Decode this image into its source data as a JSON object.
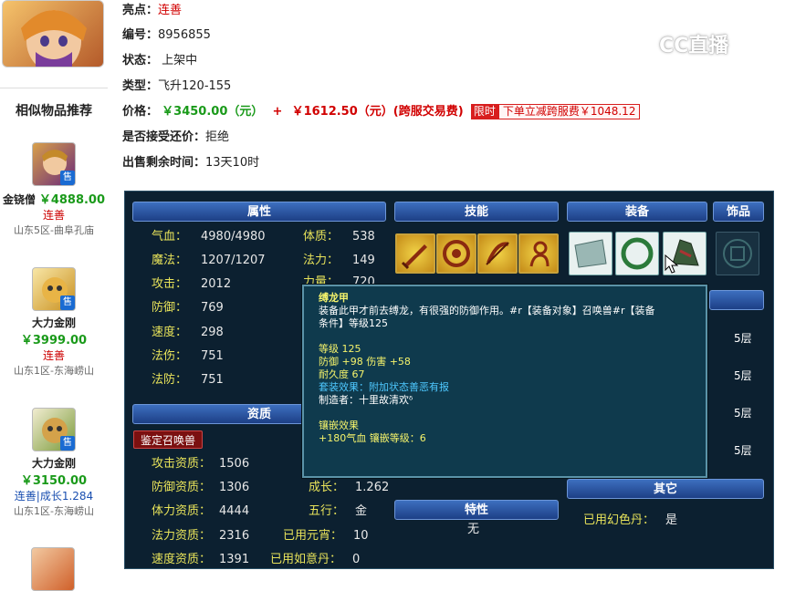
{
  "logo": "CC直播",
  "sidebar": {
    "title": "相似物品推荐",
    "sold_badge": "售",
    "items": [
      {
        "name": "金铙僧",
        "price": "￥4888.00",
        "highlight": "连善",
        "server": "山东5区-曲阜孔庙"
      },
      {
        "name": "大力金刚",
        "price": "￥3999.00",
        "highlight": "连善",
        "server": "山东1区-东海崂山"
      },
      {
        "name": "大力金刚",
        "price": "￥3150.00",
        "highlight": "连善|成长1.284",
        "server": "山东1区-东海崂山"
      }
    ]
  },
  "info": {
    "highlight_label": "亮点：",
    "highlight_value": "连善",
    "id_label": "编号：",
    "id_value": "8956855",
    "status_label": "状态：",
    "status_value": "上架中",
    "type_label": "类型：",
    "type_value": "飞升120-155",
    "price_label": "价格：",
    "price_main": "￥3450.00（元）",
    "price_plus": "+",
    "price_extra": "￥1612.50（元）(跨服交易费)",
    "limit_badge": "限时",
    "limit_offer": "下单立减跨服费￥1048.12",
    "bargain_label": "是否接受还价：",
    "bargain_value": "拒绝",
    "remain_label": "出售剩余时间：",
    "remain_value": "13天10时"
  },
  "panel": {
    "headers": {
      "attributes": "属性",
      "skills": "技能",
      "equipment": "装备",
      "accessory": "饰品",
      "aptitude": "资质",
      "trait": "特性",
      "other": "其它"
    },
    "attrs_left": [
      {
        "k": "气血：",
        "v": "4980/4980"
      },
      {
        "k": "魔法：",
        "v": "1207/1207"
      },
      {
        "k": "攻击：",
        "v": "2012"
      },
      {
        "k": "防御：",
        "v": "769"
      },
      {
        "k": "速度：",
        "v": "298"
      },
      {
        "k": "法伤：",
        "v": "751"
      },
      {
        "k": "法防：",
        "v": "751"
      }
    ],
    "attrs_right": [
      {
        "k": "体质：",
        "v": "538"
      },
      {
        "k": "法力：",
        "v": "149"
      },
      {
        "k": "力量：",
        "v": "720"
      }
    ],
    "appraise_button": "鉴定召唤兽",
    "aptitudes": [
      {
        "k": "攻击资质：",
        "v": "1506"
      },
      {
        "k": "防御资质：",
        "v": "1306"
      },
      {
        "k": "体力资质：",
        "v": "4444"
      },
      {
        "k": "法力资质：",
        "v": "2316"
      },
      {
        "k": "速度资质：",
        "v": "1391"
      }
    ],
    "apt_right": [
      {
        "k": "成长：",
        "v": "1.262"
      },
      {
        "k": "五行：",
        "v": "金"
      },
      {
        "k": "已用元宵：",
        "v": "10"
      },
      {
        "k": "已用如意丹：",
        "v": "0"
      }
    ],
    "trait_value": "无",
    "other_key": "已用幻色丹：",
    "other_value": "是",
    "layers": [
      "5层",
      "5层",
      "5层",
      "5层"
    ]
  },
  "tooltip": {
    "title": "缚龙甲",
    "desc1": "装备此甲才前去缚龙，有很强的防御作用。#r【装备对象】召唤兽#r【装备",
    "desc2": "条件】等级125",
    "level": "等级 125",
    "stats": "防御 +98 伤害 +58",
    "durability": "耐久度 67",
    "set_effect": "套装效果：附加状态善恶有报",
    "maker": "制造者：十里故清欢ᵟ",
    "inlay_title": "镶嵌效果",
    "inlay": "+180气血 镶嵌等级：6"
  }
}
